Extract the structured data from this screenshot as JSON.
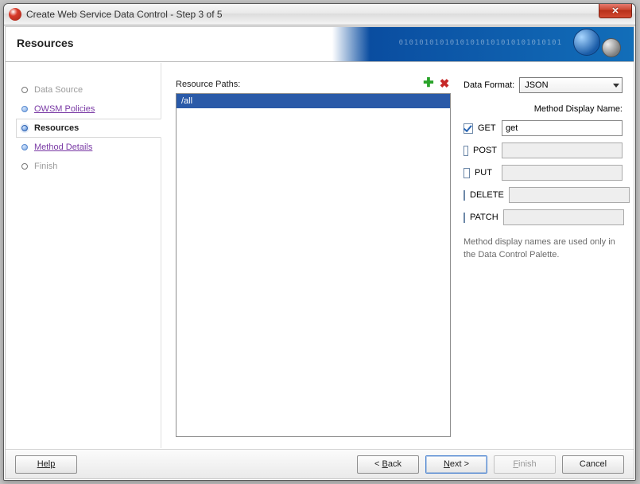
{
  "window": {
    "title": "Create Web Service Data Control - Step 3 of 5"
  },
  "banner": {
    "title": "Resources",
    "binary": "01010101010101010101010101010101"
  },
  "steps": [
    {
      "label": "Data Source",
      "state": "disabled"
    },
    {
      "label": "OWSM Policies",
      "state": "done"
    },
    {
      "label": "Resources",
      "state": "active"
    },
    {
      "label": "Method Details",
      "state": "done"
    },
    {
      "label": "Finish",
      "state": "disabled"
    }
  ],
  "paths": {
    "label": "Resource Paths:",
    "items": [
      "/all"
    ]
  },
  "data_format": {
    "label": "Data Format:",
    "value": "JSON"
  },
  "method_section": {
    "header": "Method Display Name:",
    "methods": [
      {
        "name": "GET",
        "checked": true,
        "display": "get"
      },
      {
        "name": "POST",
        "checked": false,
        "display": ""
      },
      {
        "name": "PUT",
        "checked": false,
        "display": ""
      },
      {
        "name": "DELETE",
        "checked": false,
        "display": ""
      },
      {
        "name": "PATCH",
        "checked": false,
        "display": ""
      }
    ],
    "hint": "Method display names are used only in the Data Control Palette."
  },
  "buttons": {
    "help": "Help",
    "back_prefix": "< ",
    "back_letter": "B",
    "back_rest": "ack",
    "next_letter": "N",
    "next_rest": "ext >",
    "finish_pre": "",
    "finish_letter": "F",
    "finish_rest": "inish",
    "cancel": "Cancel"
  }
}
